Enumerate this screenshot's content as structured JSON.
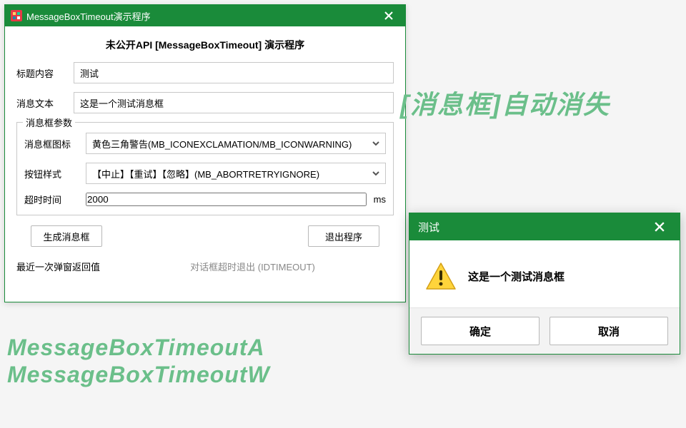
{
  "app": {
    "title": "MessageBoxTimeout演示程序",
    "header": "未公开API [MessageBoxTimeout] 演示程序",
    "labels": {
      "title_content": "标题内容",
      "message_text": "消息文本",
      "group": "消息框参数",
      "icon": "消息框图标",
      "button_style": "按钮样式",
      "timeout": "超时时间",
      "unit": "ms",
      "recent": "最近一次弹窗返回值"
    },
    "fields": {
      "title_value": "测试",
      "message_value": "这是一个测试消息框",
      "icon_selected": "黄色三角警告(MB_ICONEXCLAMATION/MB_ICONWARNING)",
      "buttons_selected": "【中止】【重试】【忽略】(MB_ABORTRETRYIGNORE)",
      "timeout_value": "2000"
    },
    "buttons": {
      "generate": "生成消息框",
      "exit": "退出程序"
    },
    "status_value": "对话框超时退出 (IDTIMEOUT)"
  },
  "captions": {
    "top": "[消息框]自动消失",
    "left_line1": "MessageBoxTimeoutA",
    "left_line2": "MessageBoxTimeoutW"
  },
  "msgbox": {
    "title": "测试",
    "text": "这是一个测试消息框",
    "ok": "确定",
    "cancel": "取消"
  },
  "colors": {
    "accent": "#1a8b3a",
    "caption_green": "#6bbf8a"
  }
}
